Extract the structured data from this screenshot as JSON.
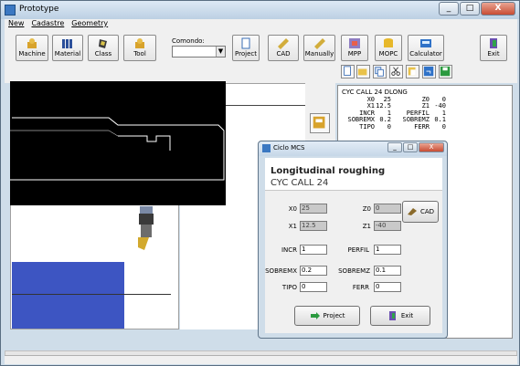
{
  "window": {
    "title": "Prototype",
    "min": "_",
    "max": "□",
    "close": "X"
  },
  "menu": [
    "New",
    "Cadastre",
    "Geometry"
  ],
  "toolbar": {
    "machine": "Machine",
    "material": "Material",
    "class": "Class",
    "tool": "Tool",
    "comando_label": "Comondo:",
    "comando_value": "",
    "project": "Project",
    "cad": "CAD",
    "manually": "Manually",
    "mpp": "MPP",
    "mopc": "MOPC",
    "calculator": "Calculator",
    "exit": "Exit"
  },
  "code_panel": {
    "header": "CYC CALL  24 DLONG",
    "rows": [
      [
        "X0",
        "25",
        "Z0",
        "0"
      ],
      [
        "X1",
        "12.5",
        "Z1",
        "-40"
      ],
      [
        "INCR",
        "1",
        "PERFIL",
        "1"
      ],
      [
        "SOBREMX",
        "0.2",
        "SOBREMZ",
        "0.1"
      ],
      [
        "TIPO",
        "0",
        "FERR",
        "0"
      ]
    ]
  },
  "dialog": {
    "title": "Ciclo MCS",
    "heading": "Longitudinal roughing",
    "subheading": "CYC CALL 24",
    "fields": {
      "x0": {
        "label": "X0",
        "value": "25"
      },
      "z0": {
        "label": "Z0",
        "value": "0"
      },
      "x1": {
        "label": "X1",
        "value": "12.5"
      },
      "z1": {
        "label": "Z1",
        "value": "-40"
      },
      "incr": {
        "label": "INCR",
        "value": "1"
      },
      "perfil": {
        "label": "PERFIL",
        "value": "1"
      },
      "sobremx": {
        "label": "SOBREMX",
        "value": "0.2"
      },
      "sobremz": {
        "label": "SOBREMZ",
        "value": "0.1"
      },
      "tipo": {
        "label": "TIPO",
        "value": "0"
      },
      "ferr": {
        "label": "FERR",
        "value": "0"
      }
    },
    "cad_button": "CAD",
    "project_button": "Project",
    "exit_button": "Exit"
  },
  "colors": {
    "accent": "#3d55c2"
  }
}
